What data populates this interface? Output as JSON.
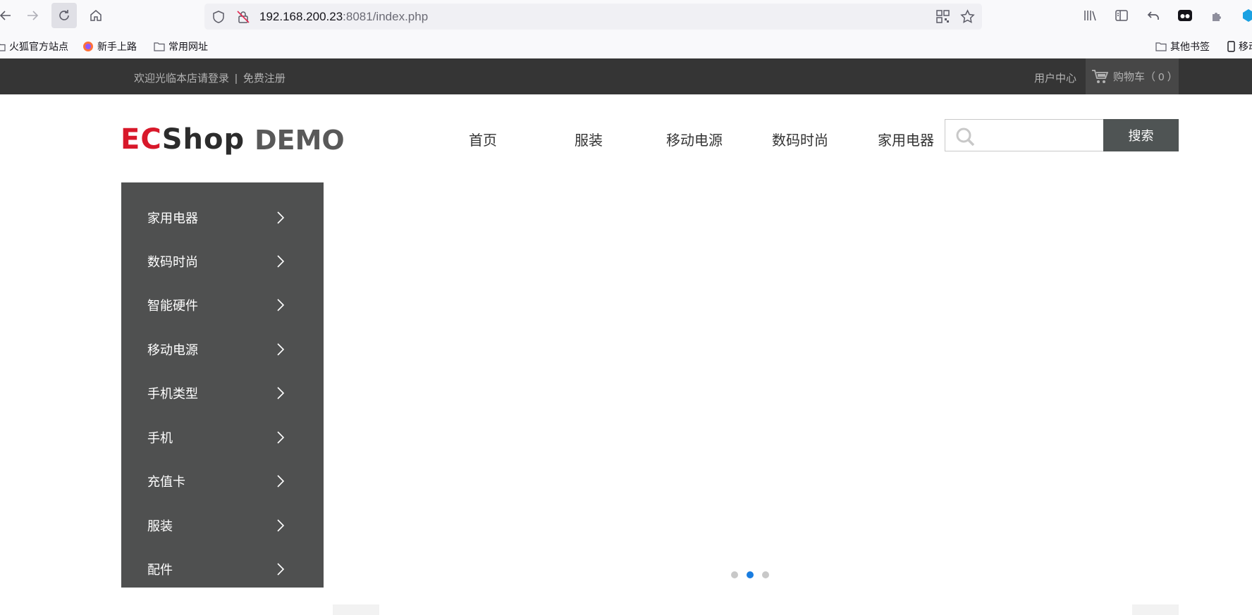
{
  "browser": {
    "url_host": "192.168.200.23",
    "url_rest": ":8081/index.php",
    "bookmarks": [
      "火狐官方站点",
      "新手上路",
      "常用网址"
    ],
    "other_bookmarks": "其他书签",
    "mobile_bookmarks": "移动"
  },
  "topbar": {
    "welcome": "欢迎光临本店请登录",
    "separator": "|",
    "register": "免费注册",
    "user_center": "用户中心",
    "cart": "购物车（ 0 ）"
  },
  "header": {
    "logo_ec": "EC",
    "logo_shop": "Shop",
    "logo_demo": "DEMO",
    "nav": [
      "首页",
      "服装",
      "移动电源",
      "数码时尚",
      "家用电器"
    ],
    "search_placeholder": "",
    "search_button": "搜索"
  },
  "categories": [
    "家用电器",
    "数码时尚",
    "智能硬件",
    "移动电源",
    "手机类型",
    "手机",
    "充值卡",
    "服装",
    "配件"
  ],
  "slider": {
    "dots": 3,
    "active_dot": 2,
    "dot_color": "#c8c8c8",
    "active_color": "#1a7de0"
  },
  "colors": {
    "topbar_bg": "#353535",
    "menu_bg": "#4f5050",
    "search_btn_bg": "#4f5454",
    "logo_red": "#d8182a"
  }
}
